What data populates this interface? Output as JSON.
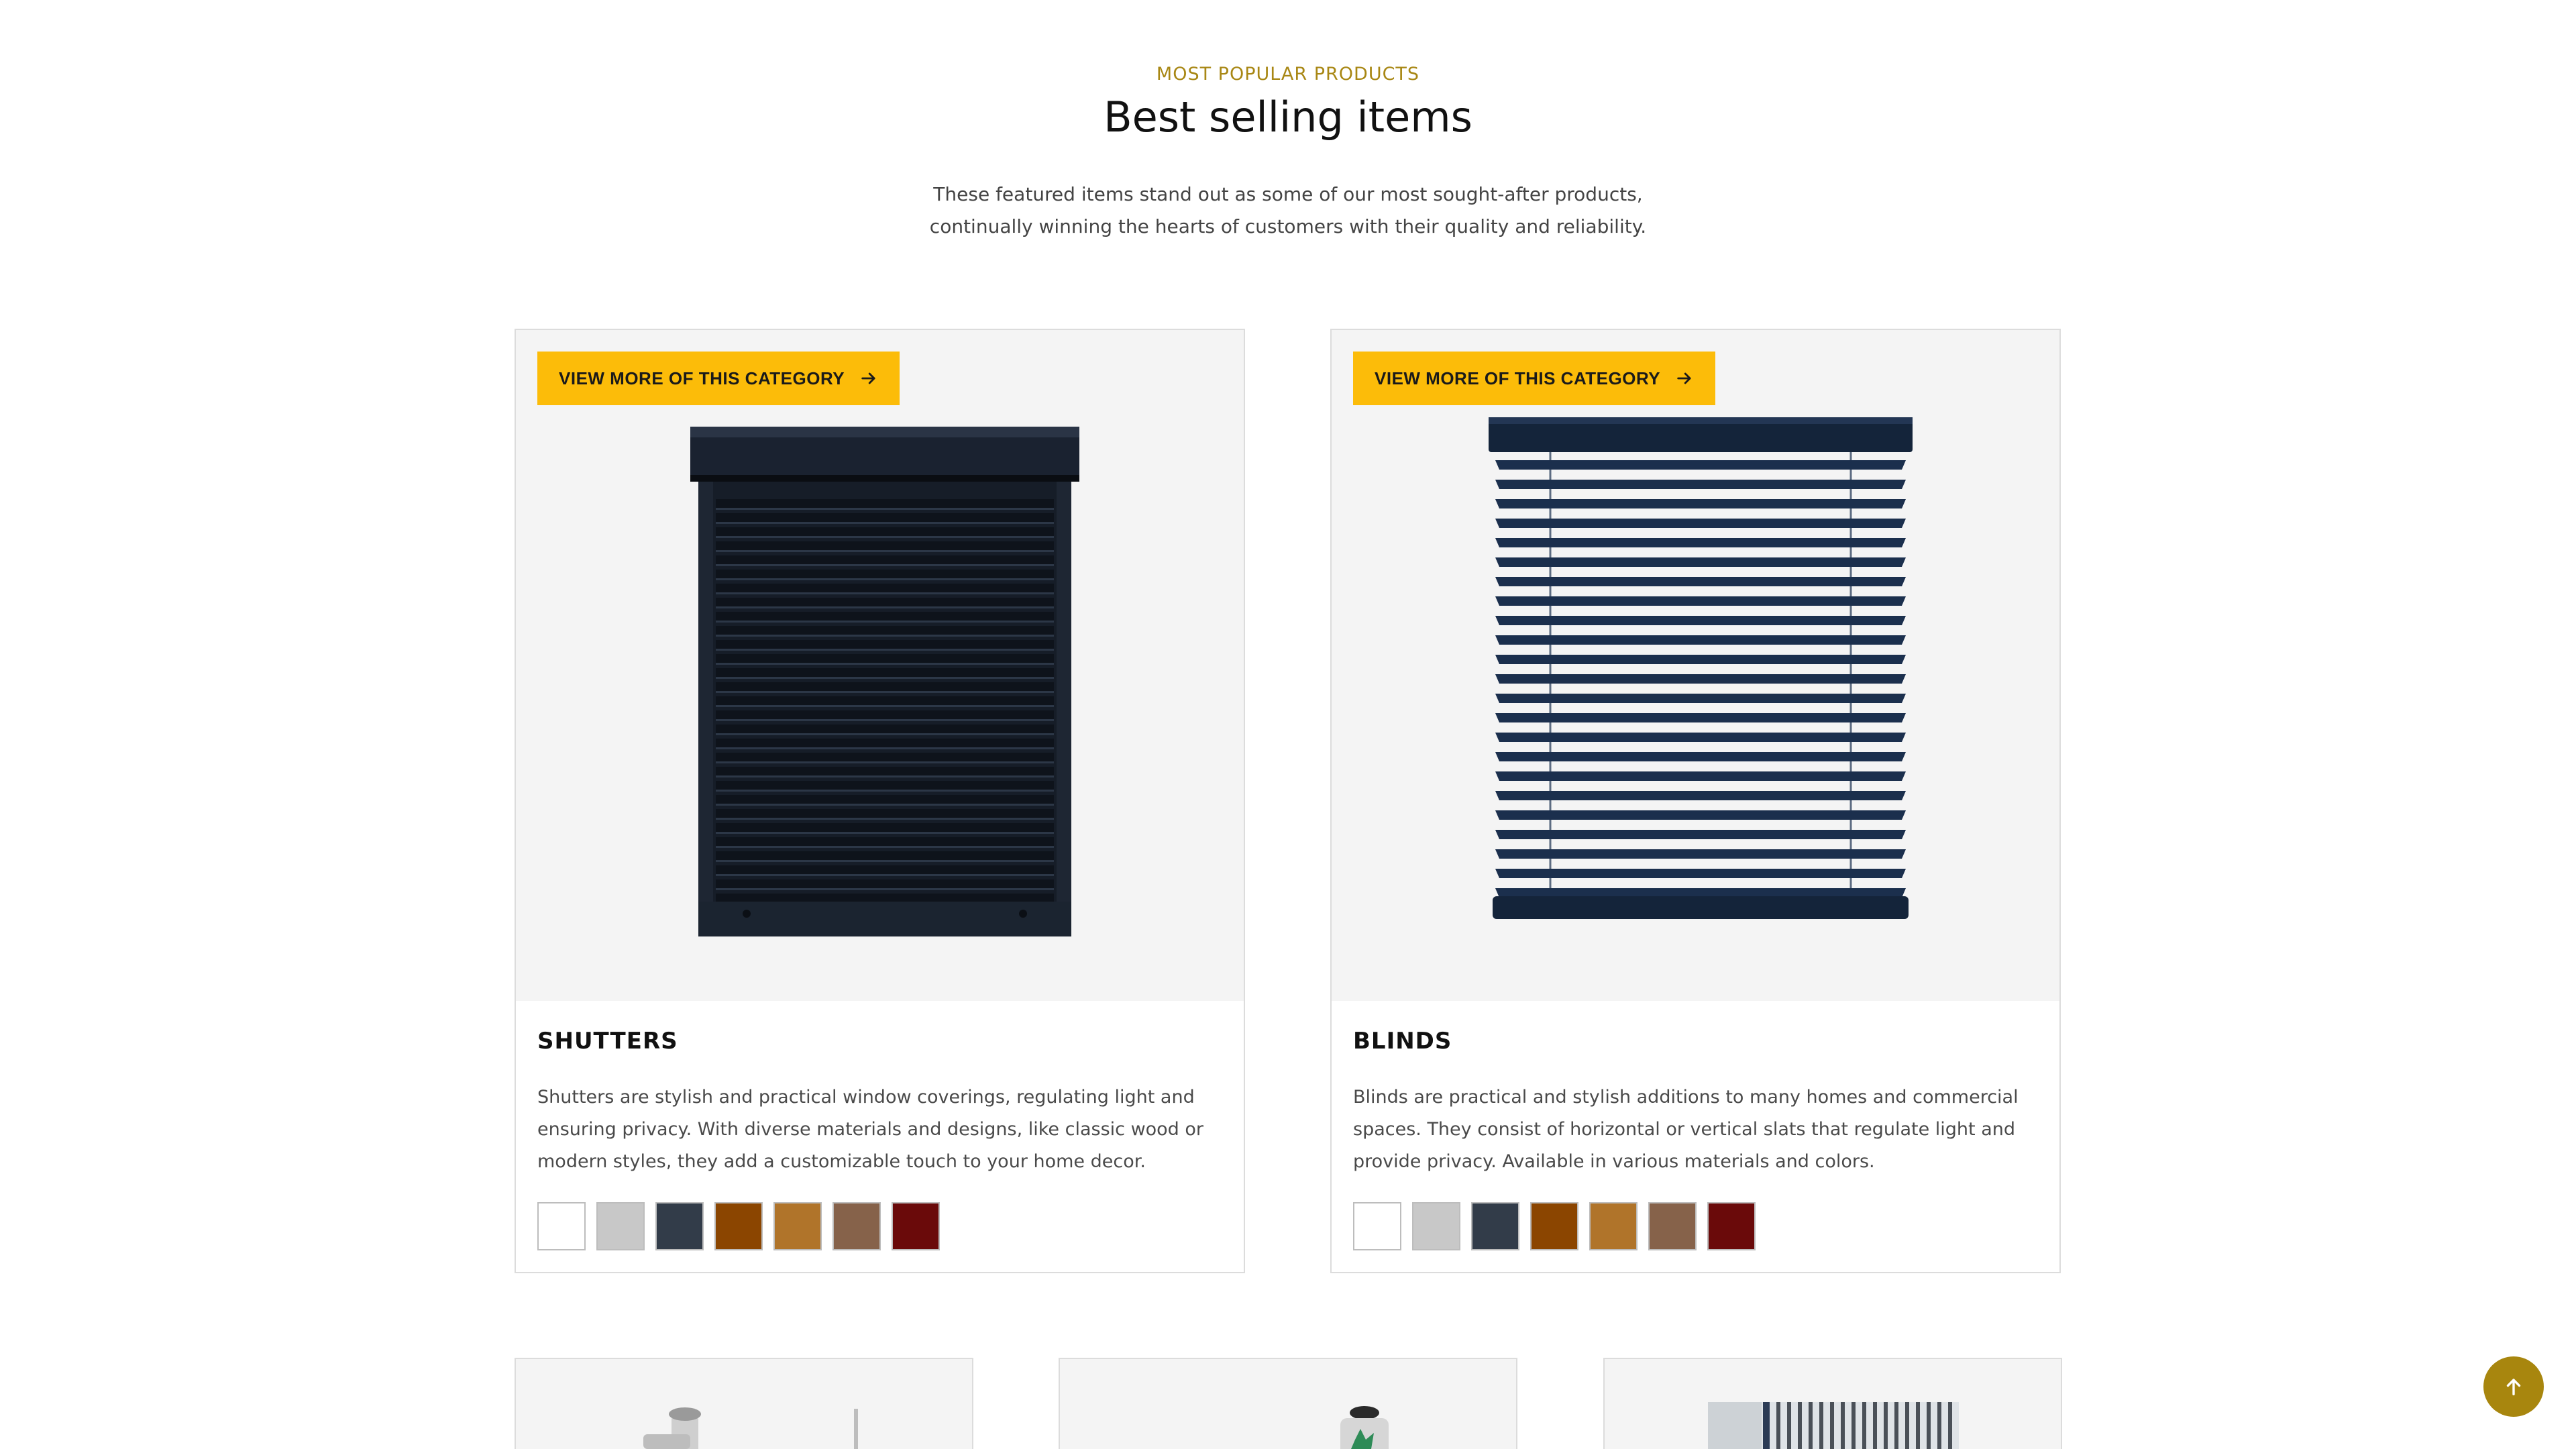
{
  "section": {
    "eyebrow": "MOST POPULAR PRODUCTS",
    "title": "Best selling items",
    "subtitle_line1": "These featured items stand out as some of our most sought-after products,",
    "subtitle_line2": "continually winning the hearts of customers with their quality and reliability."
  },
  "products": [
    {
      "button_label": "VIEW MORE OF THIS CATEGORY",
      "title": "SHUTTERS",
      "description": "Shutters are stylish and practical window coverings, regulating light and ensuring privacy. With diverse materials and designs, like classic wood or modern styles, they add a customizable touch to your home decor.",
      "image_icon": "roller-shutter-image"
    },
    {
      "button_label": "VIEW MORE OF THIS CATEGORY",
      "title": "BLINDS",
      "description": "Blinds are practical and stylish additions to many homes and commercial spaces. They consist of horizontal or vertical slats that regulate light and provide privacy. Available in various materials and colors.",
      "image_icon": "venetian-blinds-image"
    }
  ],
  "swatch_colors": [
    "#ffffff",
    "#c8c8c8",
    "#323c49",
    "#8b4500",
    "#b0742a",
    "#86624a",
    "#6a0a0a"
  ],
  "colors": {
    "accent_yellow": "#fcbc09",
    "accent_gold": "#a8860e",
    "eyebrow_gold": "#a88714"
  },
  "icons": {
    "button_arrow": "arrow-right-icon",
    "back_to_top": "arrow-up-icon"
  }
}
